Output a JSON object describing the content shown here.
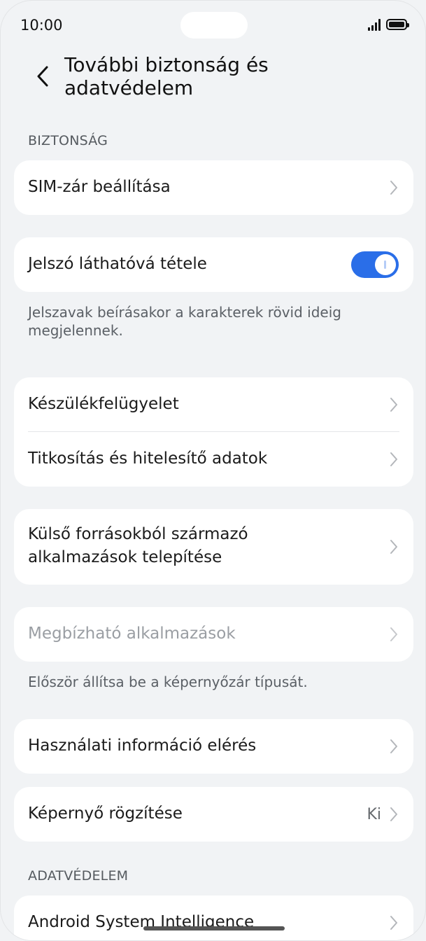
{
  "status_bar": {
    "time": "10:00"
  },
  "header": {
    "title": "További biztonság és adatvédelem"
  },
  "sections": {
    "security": "BIZTONSÁG",
    "privacy": "ADATVÉDELEM"
  },
  "items": {
    "sim_lock": "SIM-zár beállítása",
    "show_password": "Jelszó láthatóvá tétele",
    "device_admin": "Készülékfelügyelet",
    "encryption": "Titkosítás és hitelesítő adatok",
    "external_sources": "Külső forrásokból származó alkalmazások telepítése",
    "trusted_apps": "Megbízható alkalmazások",
    "usage_access": "Használati információ elérés",
    "screen_pinning": "Képernyő rögzítése",
    "screen_pinning_value": "Ki",
    "android_intelligence": "Android System Intelligence"
  },
  "helpers": {
    "show_password": "Jelszavak beírásakor a karakterek rövid ideig megjelennek.",
    "trusted_apps": "Először állítsa be a képernyőzár típusát."
  },
  "toggles": {
    "show_password_on": true
  },
  "colors": {
    "accent": "#2a6ee8",
    "background": "#f1f3f5",
    "card": "#ffffff"
  }
}
